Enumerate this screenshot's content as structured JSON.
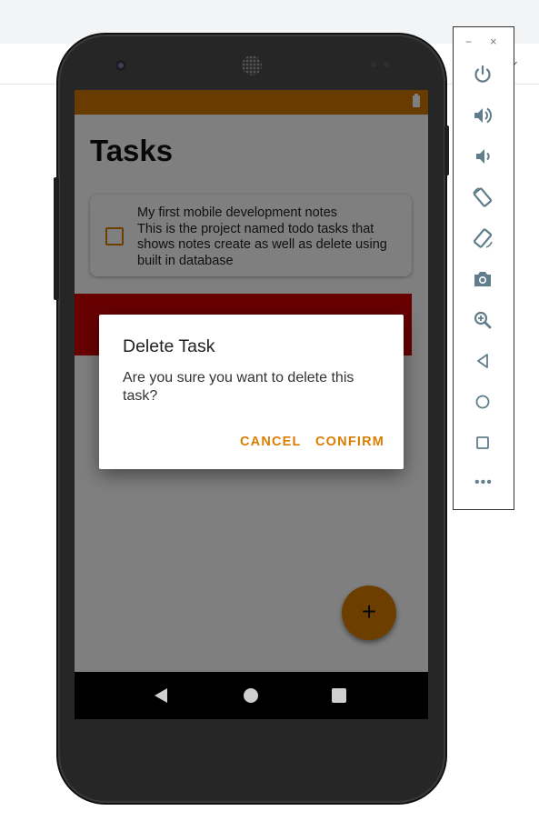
{
  "app": {
    "screen_title": "Tasks",
    "task": {
      "title": "My first mobile development notes",
      "description": "This is the project named todo tasks that shows notes create as well as delete using built in database"
    },
    "fab_label": "+"
  },
  "dialog": {
    "title": "Delete Task",
    "message": "Are you sure you want to delete this task?",
    "cancel_label": "CANCEL",
    "confirm_label": "CONFIRM"
  },
  "emulator_toolbar": {
    "minimize_label": "−",
    "close_label": "×",
    "more_label": "•••",
    "tools": [
      "power-icon",
      "volume-up-icon",
      "volume-down-icon",
      "rotate-left-icon",
      "rotate-right-icon",
      "camera-icon",
      "zoom-icon",
      "back-icon",
      "home-icon",
      "overview-icon",
      "more-icon"
    ]
  },
  "colors": {
    "accent": "#d97e00",
    "delete_background": "#d00000",
    "toolbar_icon": "#607d8b"
  }
}
